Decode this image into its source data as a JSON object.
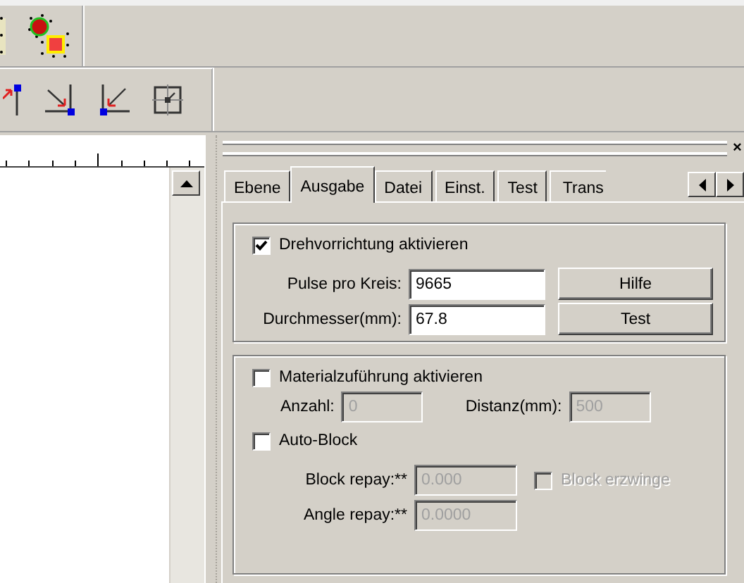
{
  "panel": {
    "close": "×"
  },
  "tabs": [
    {
      "label": "Ebene",
      "selected": false
    },
    {
      "label": "Ausgabe",
      "selected": true
    },
    {
      "label": "Datei",
      "selected": false
    },
    {
      "label": "Einst.",
      "selected": false
    },
    {
      "label": "Test",
      "selected": false
    },
    {
      "label": "Trans",
      "selected": false
    }
  ],
  "rotary": {
    "label": "Drehvorrichtung aktivieren",
    "checked": true,
    "fields": [
      {
        "label": "Pulse pro Kreis:",
        "value": "9665",
        "button": "Hilfe"
      },
      {
        "label": "Durchmesser(mm):",
        "value": "67.8",
        "button": "Test"
      }
    ]
  },
  "feed": {
    "label": "Materialzuführung aktivieren",
    "checked": false,
    "count": {
      "label": "Anzahl:",
      "value": "0",
      "disabled": true
    },
    "distance": {
      "label": "Distanz(mm):",
      "value": "500",
      "disabled": true
    }
  },
  "auto_block": {
    "label": "Auto-Block",
    "checked": false,
    "block_repay": {
      "label": "Block repay:**",
      "value": "0.000",
      "disabled": true
    },
    "force": {
      "label": "Block erzwinge",
      "checked": false,
      "disabled": true
    },
    "angle_repay": {
      "label": "Angle repay:**",
      "value": "0.0000",
      "disabled": true
    }
  }
}
